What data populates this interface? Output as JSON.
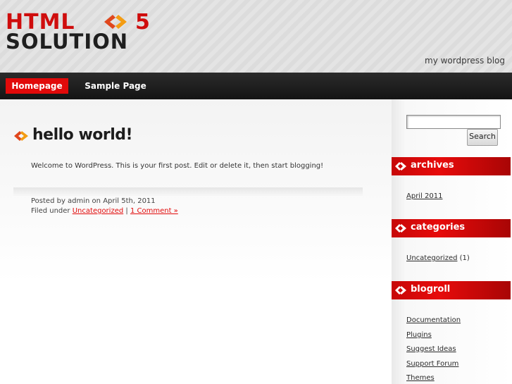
{
  "header": {
    "logo_line1": "HTML",
    "logo_line2": "SOLUTION",
    "logo_number": "5",
    "tagline": "my wordpress blog"
  },
  "nav": {
    "items": [
      {
        "label": "Homepage",
        "active": true
      },
      {
        "label": "Sample Page",
        "active": false
      }
    ]
  },
  "post": {
    "title": "hello world!",
    "body": "Welcome to WordPress. This is your first post. Edit or delete it, then start blogging!",
    "posted_by": "Posted by admin on April 5th, 2011",
    "filed_under": "Filed under",
    "category_link": "Uncategorized",
    "separator": "|",
    "comments_link": "1 Comment »"
  },
  "sidebar": {
    "search_value": "",
    "search_button": "Search",
    "archives": {
      "title": "archives",
      "items": [
        "April 2011"
      ]
    },
    "categories": {
      "title": "categories",
      "items": [
        {
          "label": "Uncategorized",
          "count": "(1)"
        }
      ]
    },
    "blogroll": {
      "title": "blogroll",
      "items": [
        "Documentation",
        "Plugins",
        "Suggest Ideas",
        "Support Forum",
        "Themes"
      ]
    }
  },
  "colors": {
    "accent": "#e10a0a",
    "nav_bg": "#1e1e1e"
  }
}
